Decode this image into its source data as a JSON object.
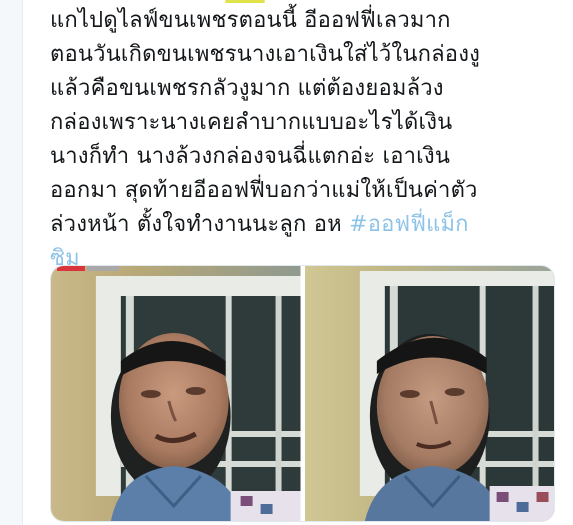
{
  "tweet": {
    "lines": [
      "แกไปดูไลฟ์ขนเพชรตอนนี้ อีออฟฟี่เลวมาก",
      "ตอนวันเกิดขนเพชรนางเอาเงินใส่ไว้ในกล่องงู",
      "แล้วคือขนเพชรกลัวงูมาก แต่ต้องยอมล้วง",
      "กล่องเพราะนางเคยลำบากแบบอะไรได้เงิน",
      "นางก็ทำ นางล้วงกล่องจนฉี่แตกอ่ะ เอาเงิน",
      "ออกมา สุดท้ายอีออฟฟี่บอกว่าแม่ให้เป็นค่าตัว",
      "ล่วงหน้า ตั้งใจทำงานนะลูก อห "
    ],
    "hashtag_part1": "#ออฟฟี่แม็ก",
    "hashtag_part2": "ซิม"
  },
  "media": {
    "count": 2,
    "images": [
      {
        "description": "photo-left"
      },
      {
        "description": "photo-right"
      }
    ]
  },
  "colors": {
    "text": "#14171a",
    "hashtag": "#8ec3e8",
    "border": "#e1e8ed"
  }
}
